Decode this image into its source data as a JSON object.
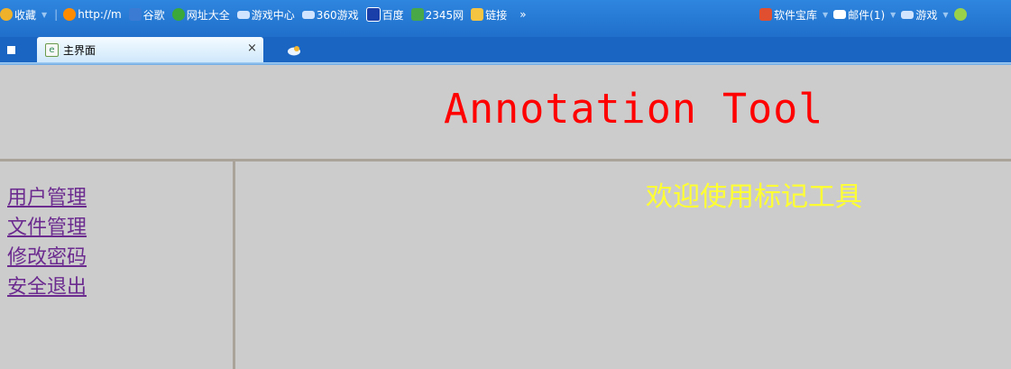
{
  "favorites_bar": {
    "left_items": [
      {
        "label": "收藏",
        "icon": "star-folder-icon",
        "color": "#f0b12a"
      },
      {
        "label": "http://m",
        "icon": "orange-circle-icon",
        "color": "#ff8c00"
      },
      {
        "label": "谷歌",
        "icon": "google-icon",
        "color": "#3b7bd4"
      },
      {
        "label": "网址大全",
        "icon": "ie-e-icon",
        "color": "#3aa83a"
      },
      {
        "label": "游戏中心",
        "icon": "gamepad-icon",
        "color": "#d0e4ff"
      },
      {
        "label": "360游戏",
        "icon": "gamepad-icon",
        "color": "#d0e4ff"
      },
      {
        "label": "百度",
        "icon": "baidu-paw-icon",
        "color": "#1a3fa8"
      },
      {
        "label": "2345网",
        "icon": "house-icon",
        "color": "#48a848"
      },
      {
        "label": "链接",
        "icon": "folder-icon",
        "color": "#f5c542"
      }
    ],
    "overflow": "»",
    "right_items": [
      {
        "label": "软件宝库",
        "icon": "software-icon",
        "color": "#e05030"
      },
      {
        "label": "邮件(1)",
        "icon": "mail-icon",
        "color": "#ffffff"
      },
      {
        "label": "游戏",
        "icon": "gamepad-icon",
        "color": "#d0e4ff"
      }
    ]
  },
  "tabs": [
    {
      "title": "主界面",
      "close": "×"
    }
  ],
  "page": {
    "header_title": "Annotation Tool",
    "welcome_text": "欢迎使用标记工具",
    "nav_links": [
      "用户管理",
      "文件管理",
      "修改密码",
      "安全退出"
    ]
  },
  "colors": {
    "page_background": "#cccccc",
    "title": "#ff0000",
    "welcome": "#ffff33",
    "link": "#6b2b8f",
    "divider": "#a9a39a"
  }
}
